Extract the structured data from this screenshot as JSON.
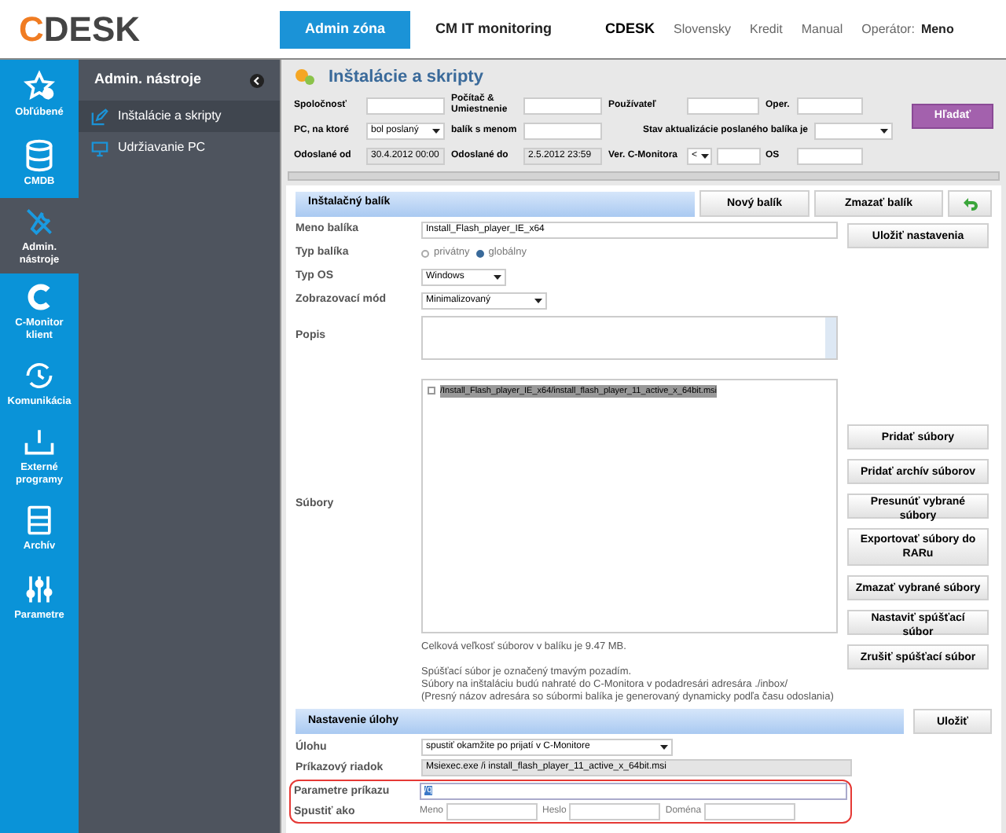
{
  "logo": {
    "mark": "C",
    "text": "DESK"
  },
  "nav_tabs": [
    {
      "label": "Admin zóna",
      "selected": true
    },
    {
      "label": "CM IT monitoring",
      "selected": false
    }
  ],
  "top_links": [
    {
      "label": "CDESK",
      "kind": "brand"
    },
    {
      "label": "Slovensky",
      "kind": "link"
    },
    {
      "label": "Kredit",
      "kind": "link"
    },
    {
      "label": "Manual",
      "kind": "link"
    }
  ],
  "operator": {
    "label": "Operátor:",
    "name": "Meno"
  },
  "rail": [
    {
      "label": "Obľúbené",
      "kind": "star",
      "selected": false
    },
    {
      "label": "CMDB",
      "kind": "database",
      "selected": false
    },
    {
      "label": "Admin. nástroje",
      "kind": "tools",
      "selected": true
    },
    {
      "label": "C-Monitor klient",
      "kind": "c",
      "selected": false
    },
    {
      "label": "Komunikácia",
      "kind": "sync",
      "selected": false
    },
    {
      "label": "Externé programy",
      "kind": "upload",
      "selected": false
    },
    {
      "label": "Archív",
      "kind": "archive",
      "selected": false
    },
    {
      "label": "Parametre",
      "kind": "sliders",
      "selected": false
    }
  ],
  "panel": {
    "title": "Admin. nástroje",
    "items": [
      {
        "label": "Inštalácie a skripty",
        "kind": "edit",
        "selected": true
      },
      {
        "label": "Udržiavanie PC",
        "kind": "monitor",
        "selected": false
      }
    ]
  },
  "page_title": "Inštalácie a skripty",
  "filters": [
    [
      {
        "label": "Spoločnosť",
        "kind": "text"
      },
      {
        "label": "Počítač & Umiestnenie",
        "kind": "text"
      },
      {
        "label": "Používateľ",
        "kind": "text"
      },
      {
        "label": "Oper.",
        "kind": "text"
      }
    ],
    [
      {
        "label": "PC, na ktoré",
        "kind": "select",
        "value": "bol poslaný"
      },
      {
        "label": "balík s menom",
        "kind": "text"
      },
      {
        "label": "Stav aktualizácie poslaného balíka je",
        "kind": "wideselect"
      }
    ],
    [
      {
        "label": "Odoslané od",
        "kind": "text",
        "value": "30.4.2012 00:00"
      },
      {
        "label": "Odoslané do",
        "kind": "text",
        "value": "2.5.2012 23:59"
      },
      {
        "label": "Ver. C-Monitora",
        "kind": "version",
        "value": "<"
      },
      {
        "label": "OS",
        "kind": "text"
      }
    ]
  ],
  "search_button": "Hľadať",
  "package": {
    "title": "Inštalačný balík",
    "buttons": [
      "Nový balík",
      "Zmazať balík"
    ],
    "save_button": "Uložiť nastavenia",
    "name_label": "Meno balíka",
    "name_value": "Install_Flash_player_IE_x64",
    "type_label": "Typ balíka",
    "type_options": [
      {
        "label": "privátny",
        "selected": false
      },
      {
        "label": "globálny",
        "selected": true
      }
    ],
    "os_label": "Typ OS",
    "os_value": "Windows",
    "mode_label": "Zobrazovací mód",
    "mode_value": "Minimalizovaný",
    "desc_label": "Popis",
    "files_label": "Súbory",
    "files": [
      {
        "name": "/Install_Flash_player_IE_x64/install_flash_player_11_active_x_64bit.msi",
        "checked": false,
        "selected": true
      }
    ],
    "file_buttons": [
      "Pridať súbory",
      "Pridať archív súborov",
      "Presunúť vybrané súbory",
      "Exportovať súbory do RARu",
      "Zmazať vybrané súbory",
      "Nastaviť spúšťací súbor",
      "Zrušiť spúšťací súbor"
    ],
    "size_note": "Celková veľkosť súborov v balíku je 9.47 MB.",
    "notes": [
      "Spúšťací súbor je označený tmavým pozadím.",
      "Súbory na inštaláciu budú nahraté do C-Monitora v podadresári adresára ./inbox/",
      "(Presný názov adresára so súbormi balíka je generovaný dynamicky podľa času odoslania)"
    ]
  },
  "task": {
    "title": "Nastavenie úlohy",
    "save_button": "Uložiť",
    "task_label": "Úlohu",
    "task_value": "spustiť okamžite po prijatí v C-Monitore",
    "cmd_label": "Príkazový riadok",
    "cmd_value": "Msiexec.exe /i install_flash_player_11_active_x_64bit.msi",
    "params_label": "Parametre príkazu",
    "params_value": "/q",
    "runas_label": "Spustiť ako",
    "runas_fields": [
      "Meno",
      "Heslo",
      "Doména"
    ]
  }
}
